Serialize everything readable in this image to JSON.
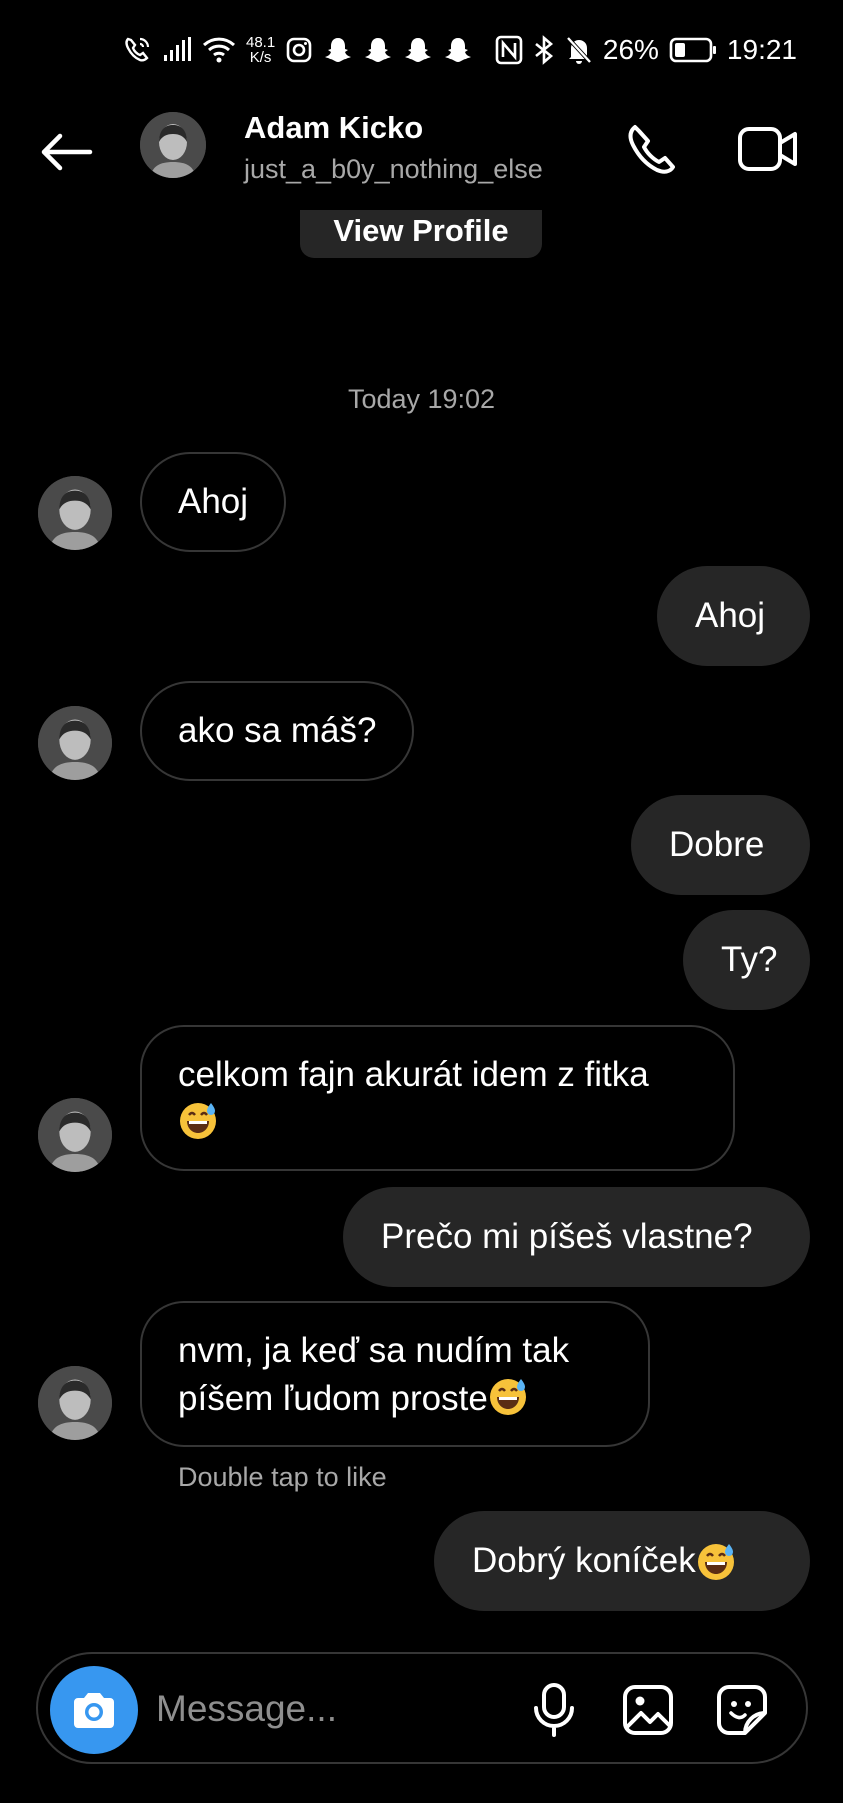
{
  "status_bar": {
    "net_speed_value": "48.1",
    "net_speed_unit": "K/s",
    "battery": "26%",
    "time": "19:21"
  },
  "header": {
    "name": "Adam Kicko",
    "username": "just_a_b0y_nothing_else"
  },
  "view_profile_label": "View Profile",
  "timestamp": "Today 19:02",
  "messages": [
    {
      "dir": "in",
      "text": "Ahoj"
    },
    {
      "dir": "out",
      "text": "Ahoj"
    },
    {
      "dir": "in",
      "text": "ako sa máš?"
    },
    {
      "dir": "out",
      "text": "Dobre"
    },
    {
      "dir": "out",
      "text": "Ty?"
    },
    {
      "dir": "in",
      "line1": "celkom fajn akurát idem z fitka",
      "line2": ""
    },
    {
      "dir": "out",
      "text": "Prečo mi píšeš vlastne?"
    },
    {
      "dir": "in",
      "line1": "nvm, ja keď sa nudím tak",
      "line2": "píšem ľudom proste"
    },
    {
      "dir": "out",
      "text": "Dobrý koníček "
    }
  ],
  "hint": "Double tap to like",
  "composer": {
    "placeholder": "Message..."
  },
  "icons": {
    "emoji": "grinning-face-with-sweat-emoji",
    "accent": "#3797f0"
  }
}
